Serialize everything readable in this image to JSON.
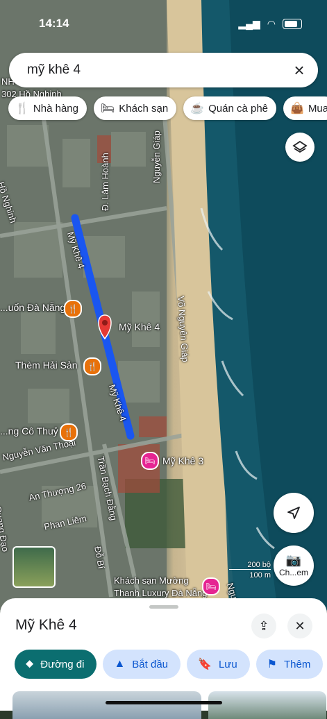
{
  "status_bar": {
    "time": "14:14"
  },
  "search": {
    "query": "mỹ khê 4"
  },
  "chips": [
    {
      "icon": "fork-knife-icon",
      "label": "Nhà hàng"
    },
    {
      "icon": "bed-icon",
      "label": "Khách sạn"
    },
    {
      "icon": "coffee-icon",
      "label": "Quán cà phê"
    },
    {
      "icon": "shopping-bag-icon",
      "label": "Mua"
    }
  ],
  "map": {
    "streets": {
      "ho_nghinh_top": "302 Hồ Nghinh",
      "ho_nghinh": "Hồ Nghinh",
      "lam_hoanh": "Đ. Lâm Hoành",
      "nguyen_giap_top": "Nguyễn Giáp",
      "my_khe_4_a": "Mỹ Khê 4",
      "my_khe_4_b": "Mỹ Khê 4",
      "vo_nguyen_giap": "Võ Nguyên Giáp",
      "nguyen_van_thoai": "Nguyễn Văn Thoại",
      "an_thuong_26": "An Thượng 26",
      "phan_liem": "Phan Liêm",
      "tran_bach_dang": "Trần Bạch Đằng",
      "do_bi": "Đỗ Bí",
      "quang_dao": "Quang Đạo",
      "nguy": "Nguy"
    },
    "places": {
      "selected": "Mỹ Khê 4",
      "poi_da_nang": "...uốn Đà Nẵng",
      "poi_hai_san": "Thèm Hải Sản",
      "poi_co_thuy": "...ng Cô Thuỷ",
      "my_khe_3": "Mỹ Khê 3",
      "hotel_line1": "Khách sạn Mường",
      "hotel_line2": "Thanh Luxury Đà Nẵng",
      "top_left_label": "NH"
    },
    "scale": {
      "imperial": "200 bộ",
      "metric": "100 m"
    },
    "camera_label": "Ch...em"
  },
  "sheet": {
    "title": "Mỹ Khê 4",
    "actions": [
      {
        "icon": "directions-icon",
        "label": "Đường đi"
      },
      {
        "icon": "navigation-arrow-icon",
        "label": "Bắt đầu"
      },
      {
        "icon": "bookmark-icon",
        "label": "Lưu"
      },
      {
        "icon": "flag-icon",
        "label": "Thêm"
      }
    ]
  },
  "colors": {
    "route": "#1a56f0",
    "pin": "#e53935",
    "primary_action": "#0b6e70",
    "action_bg": "#d3e3fd"
  }
}
